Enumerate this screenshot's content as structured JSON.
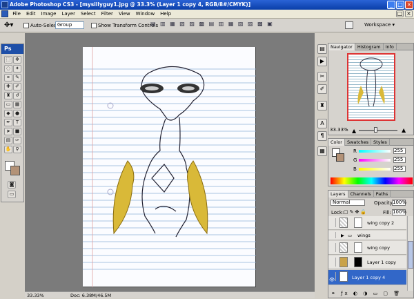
{
  "window": {
    "title": "Adobe Photoshop CS3 - [mysillyguy1.jpg @ 33.3% (Layer 1 copy 4, RGB/8#/CMYK)]"
  },
  "menu": [
    "File",
    "Edit",
    "Image",
    "Layer",
    "Select",
    "Filter",
    "View",
    "Window",
    "Help"
  ],
  "options": {
    "auto_select": "Auto-Select:",
    "group": "Group",
    "show_transform": "Show Transform Controls",
    "workspace": "Workspace ▾"
  },
  "status": {
    "zoom": "33.33%",
    "doc": "Doc: 6.38M/46.5M"
  },
  "navigator": {
    "tabs": [
      "Navigator",
      "Histogram",
      "Info"
    ],
    "zoom": "33.33%"
  },
  "color": {
    "tabs": [
      "Color",
      "Swatches",
      "Styles"
    ],
    "r_label": "R",
    "g_label": "G",
    "b_label": "B",
    "r": "255",
    "g": "255",
    "b": "255"
  },
  "layers": {
    "tabs": [
      "Layers",
      "Channels",
      "Paths"
    ],
    "blend": "Normal",
    "opacity_label": "Opacity:",
    "opacity": "100%",
    "lock_label": "Lock:",
    "fill_label": "Fill:",
    "fill": "100%",
    "items": [
      "wing copy 2",
      "wings",
      "wing copy",
      "Layer 1 copy",
      "Layer 1 copy 4"
    ]
  }
}
